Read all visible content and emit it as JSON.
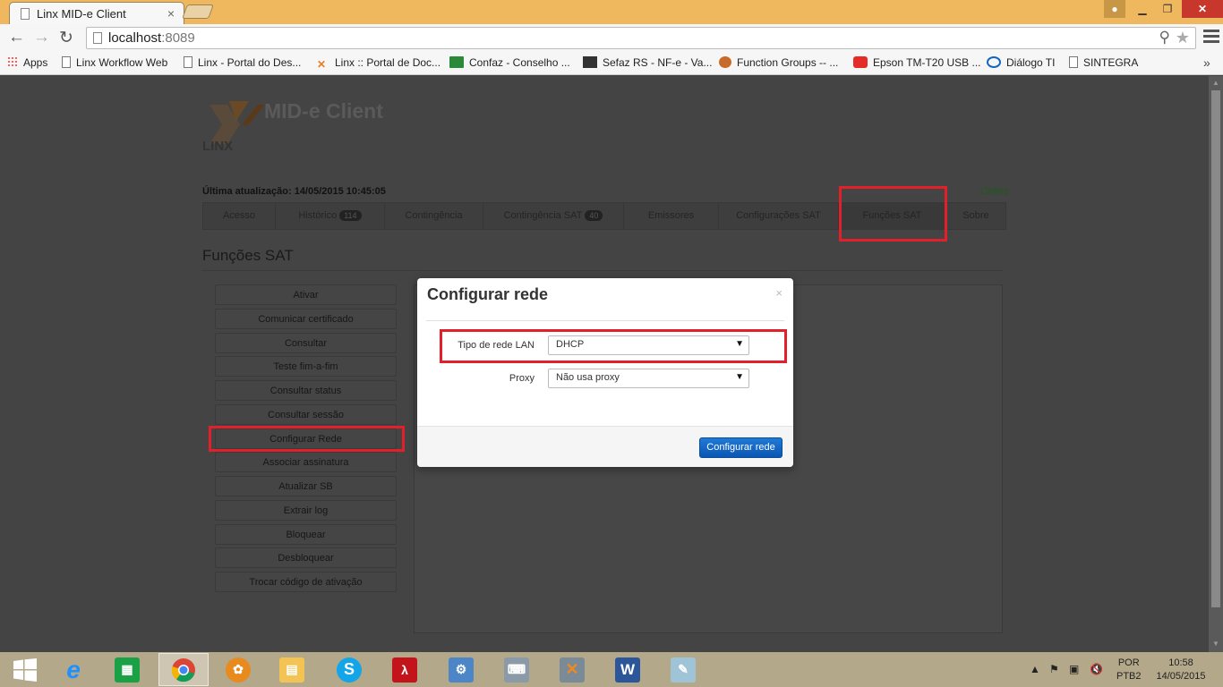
{
  "browser": {
    "tab_title": "Linx MID-e Client",
    "tab_close": "×",
    "url_host": "localhost",
    "url_port": ":8089",
    "window_buttons": {
      "minimize": "▁",
      "maximize": "❐",
      "close": "✕"
    }
  },
  "bookmarks": [
    {
      "label": "Apps",
      "icon": "apps-grid-icon"
    },
    {
      "label": "Linx Workflow Web",
      "icon": "page-icon"
    },
    {
      "label": "Linx - Portal do Des...",
      "icon": "page-icon"
    },
    {
      "label": "Linx :: Portal de Doc...",
      "icon": "linx-icon"
    },
    {
      "label": "Confaz - Conselho ...",
      "icon": "brazil-flag-icon"
    },
    {
      "label": "Sefaz RS - NF-e - Va...",
      "icon": "sefaz-icon"
    },
    {
      "label": "Function Groups -- ...",
      "icon": "sap-icon"
    },
    {
      "label": "Epson TM-T20 USB ...",
      "icon": "youtube-icon"
    },
    {
      "label": "Diálogo TI",
      "icon": "intel-icon"
    },
    {
      "label": "SINTEGRA",
      "icon": "page-icon"
    }
  ],
  "bookmarks_more": "»",
  "app": {
    "title": "MID-e Client",
    "logo_text": "LINX",
    "last_update": "Última atualização: 14/05/2015 10:45:05",
    "status": "Online"
  },
  "nav_tabs": [
    {
      "label": "Acesso",
      "badge": ""
    },
    {
      "label": "Histórico",
      "badge": "114"
    },
    {
      "label": "Contingência",
      "badge": ""
    },
    {
      "label": "Contingência SAT",
      "badge": "40"
    },
    {
      "label": "Emissores",
      "badge": ""
    },
    {
      "label": "Configurações SAT",
      "badge": ""
    },
    {
      "label": "Funções SAT",
      "badge": ""
    },
    {
      "label": "Sobre",
      "badge": ""
    }
  ],
  "section_title": "Funções SAT",
  "functions": [
    "Ativar",
    "Comunicar certificado",
    "Consultar",
    "Teste fim-a-fim",
    "Consultar status",
    "Consultar sessão",
    "Configurar Rede",
    "Associar assinatura",
    "Atualizar SB",
    "Extrair log",
    "Bloquear",
    "Desbloquear",
    "Trocar código de ativação"
  ],
  "modal": {
    "title": "Configurar rede",
    "close": "×",
    "lan_label": "Tipo de rede LAN",
    "lan_value": "DHCP",
    "proxy_label": "Proxy",
    "proxy_value": "Não usa proxy",
    "submit": "Configurar rede"
  },
  "taskbar": {
    "language_top": "POR",
    "language_bottom": "PTB2",
    "time": "10:58",
    "date": "14/05/2015",
    "apps": [
      "start-icon",
      "internet-explorer-icon",
      "windows-store-icon",
      "chrome-icon",
      "firefox-icon",
      "file-explorer-icon",
      "skype-icon",
      "acrobat-icon",
      "control-panel-icon",
      "device-manager-icon",
      "linx-icon",
      "word-icon",
      "notepad-icon"
    ]
  },
  "colors": {
    "highlight": "#e1202a",
    "primary_button": "#0b56b3",
    "titlebar": "#f0b85e"
  }
}
